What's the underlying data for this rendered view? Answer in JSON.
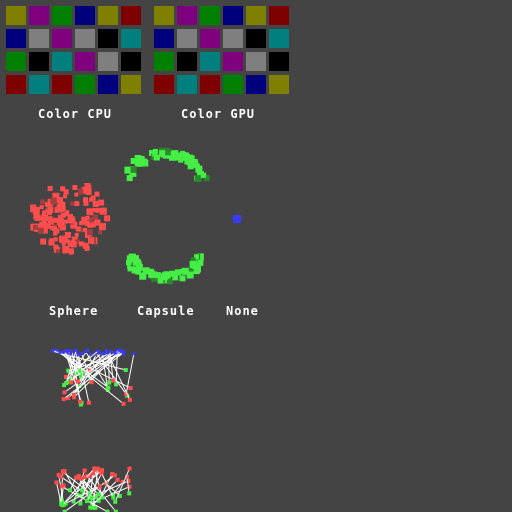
{
  "palettes": {
    "cpu": {
      "label": "Color CPU",
      "swatches": [
        "#7f7f00",
        "#7f007f",
        "#007f00",
        "#00007f",
        "#7f7f00",
        "#7f0000",
        "#00007f",
        "#7f7f7f",
        "#7f007f",
        "#7f7f7f",
        "#000000",
        "#007f7f",
        "#007f00",
        "#000000",
        "#007f7f",
        "#7f007f",
        "#7f7f7f",
        "#000000",
        "#7f0000",
        "#007f7f",
        "#7f0000",
        "#007f00",
        "#00007f",
        "#7f7f00"
      ]
    },
    "gpu": {
      "label": "Color GPU",
      "swatches": [
        "#7f7f00",
        "#7f007f",
        "#007f00",
        "#00007f",
        "#7f7f00",
        "#7f0000",
        "#00007f",
        "#7f7f7f",
        "#7f007f",
        "#7f7f7f",
        "#000000",
        "#007f7f",
        "#007f00",
        "#000000",
        "#007f7f",
        "#7f007f",
        "#7f7f7f",
        "#000000",
        "#7f0000",
        "#007f7f",
        "#7f0000",
        "#007f00",
        "#00007f",
        "#7f7f00"
      ]
    }
  },
  "emitters": {
    "sphere_label": "Sphere",
    "capsule_label": "Capsule",
    "none_label": "None"
  },
  "colors": {
    "background": "#444444",
    "sphere_particles": "#ff4d4d",
    "capsule_particles": "#44ee44",
    "none_particle": "#3a3aff",
    "trail_top": "#3a3aff",
    "trail_line": "#ffffff"
  }
}
